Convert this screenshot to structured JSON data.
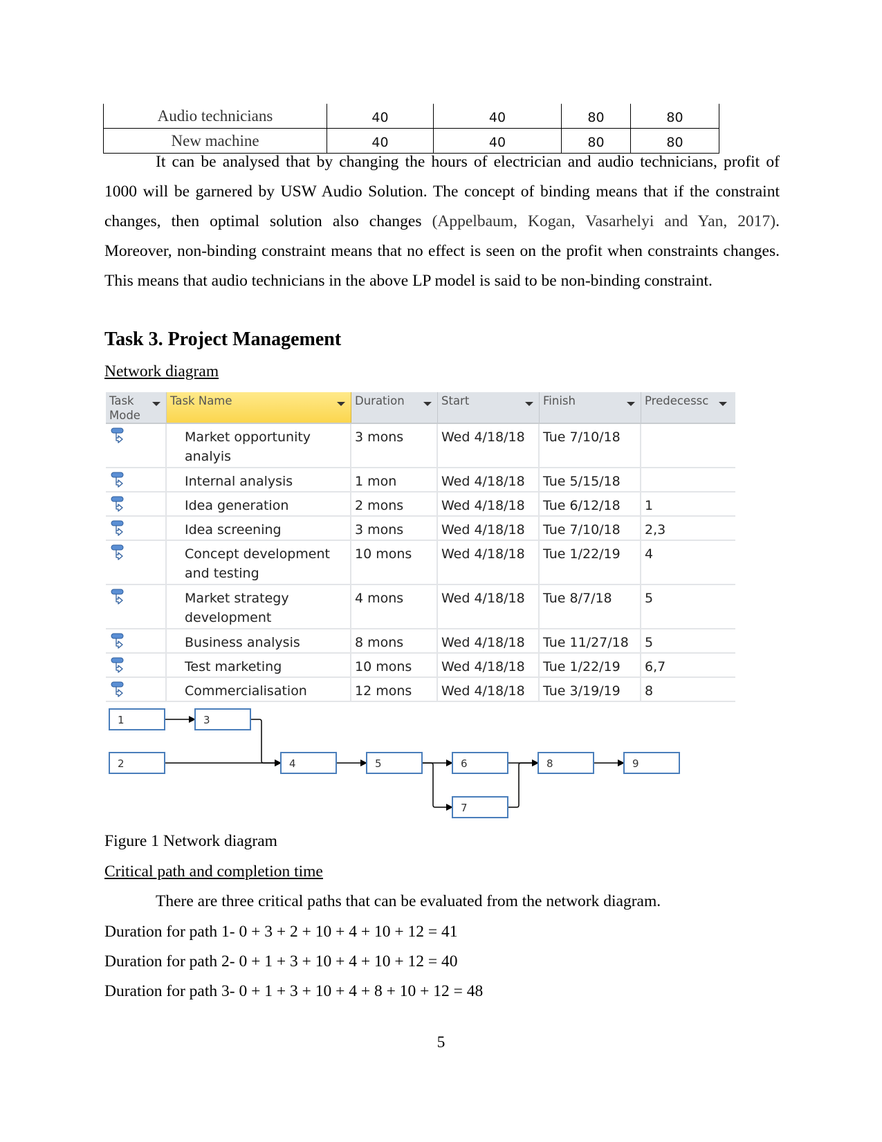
{
  "lp_table": {
    "rows": [
      {
        "name": "Audio technicians",
        "values": [
          "40",
          "40",
          "80",
          "80"
        ]
      },
      {
        "name": "New machine",
        "values": [
          "40",
          "40",
          "80",
          "80"
        ]
      }
    ]
  },
  "paragraph": {
    "part1": "It can be analysed that by changing the hours of electrician and audio technicians, profit of 1000 will be garnered by USW Audio Solution. The concept of binding means that if the constraint changes, then optimal solution also changes ",
    "citation": "(Appelbaum, Kogan, Vasarhelyi and Yan, 2017)",
    "part2": ". Moreover, non-binding constraint means that no effect is seen on the profit when constraints changes. This means that audio technicians in the above LP model is said to be non-binding constraint."
  },
  "heading": "Task 3. Project Management",
  "network_subheading": "Network diagram",
  "project_table": {
    "headers": {
      "mode_line1": "Task",
      "mode_line2": "Mode",
      "name": "Task Name",
      "duration": "Duration",
      "start": "Start",
      "finish": "Finish",
      "predecessors": "Predecessc"
    },
    "rows": [
      {
        "name_line1": "Market opportunity",
        "name_line2": "analyis",
        "duration": "3 mons",
        "start": "Wed 4/18/18",
        "finish": "Tue 7/10/18",
        "pred": ""
      },
      {
        "name_line1": "Internal analysis",
        "name_line2": "",
        "duration": "1 mon",
        "start": "Wed 4/18/18",
        "finish": "Tue 5/15/18",
        "pred": ""
      },
      {
        "name_line1": "Idea generation",
        "name_line2": "",
        "duration": "2 mons",
        "start": "Wed 4/18/18",
        "finish": "Tue 6/12/18",
        "pred": "1"
      },
      {
        "name_line1": "Idea screening",
        "name_line2": "",
        "duration": "3 mons",
        "start": "Wed 4/18/18",
        "finish": "Tue 7/10/18",
        "pred": "2,3"
      },
      {
        "name_line1": "Concept development",
        "name_line2": "and testing",
        "duration": "10 mons",
        "start": "Wed 4/18/18",
        "finish": "Tue 1/22/19",
        "pred": "4"
      },
      {
        "name_line1": "Market strategy",
        "name_line2": "development",
        "duration": "4 mons",
        "start": "Wed 4/18/18",
        "finish": "Tue 8/7/18",
        "pred": "5"
      },
      {
        "name_line1": "Business analysis",
        "name_line2": "",
        "duration": "8 mons",
        "start": "Wed 4/18/18",
        "finish": "Tue 11/27/18",
        "pred": "5"
      },
      {
        "name_line1": "Test marketing",
        "name_line2": "",
        "duration": "10 mons",
        "start": "Wed 4/18/18",
        "finish": "Tue 1/22/19",
        "pred": "6,7"
      },
      {
        "name_line1": "Commercialisation",
        "name_line2": "",
        "duration": "12 mons",
        "start": "Wed 4/18/18",
        "finish": "Tue 3/19/19",
        "pred": "8"
      }
    ]
  },
  "network_diagram": {
    "nodes": [
      "1",
      "2",
      "3",
      "4",
      "5",
      "6",
      "7",
      "8",
      "9"
    ],
    "edges": [
      [
        "1",
        "3"
      ],
      [
        "3",
        "4"
      ],
      [
        "2",
        "4"
      ],
      [
        "4",
        "5"
      ],
      [
        "5",
        "6"
      ],
      [
        "5",
        "7"
      ],
      [
        "6",
        "8"
      ],
      [
        "7",
        "8"
      ],
      [
        "8",
        "9"
      ]
    ],
    "node_border_color": "#4a7ebb"
  },
  "caption": "Figure 1 Network diagram",
  "critical_subheading": "Critical path and completion time",
  "critical_intro": "There are three critical paths that can be evaluated from the network diagram.",
  "paths": [
    "Duration for path 1- 0 + 3 + 2 + 10 + 4 + 10 + 12 = 41",
    "Duration for path 2- 0 + 1 + 3 + 10 + 4 + 10 + 12 = 40",
    "Duration for path 3- 0 + 1 + 3 + 10 + 4 + 8 + 10 + 12 = 48"
  ],
  "page_number": "5"
}
